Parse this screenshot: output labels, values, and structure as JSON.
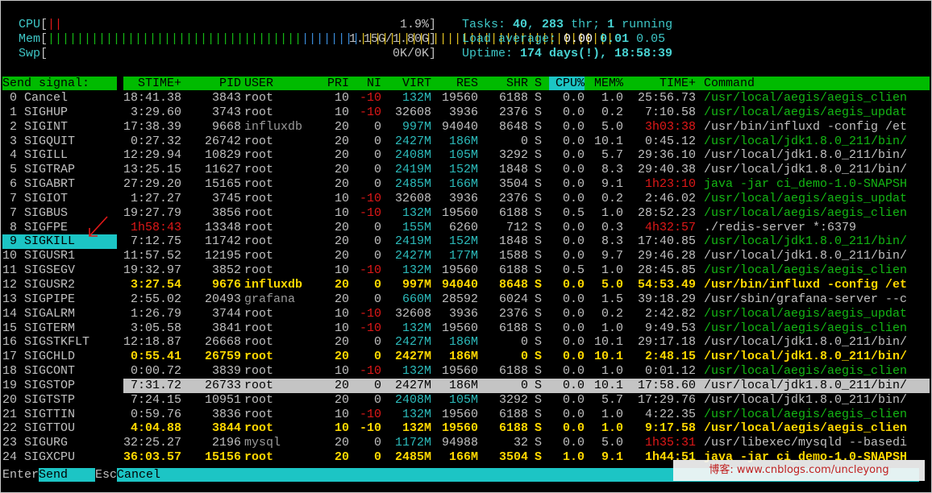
{
  "meters": [
    {
      "label": "CPU",
      "bar_text": "||",
      "bar_colors": [
        "#e01818",
        "#14b814"
      ],
      "value": "1.9%"
    },
    {
      "label": "Mem",
      "bar_text": "||||||||||||||||||||||||||||||||||||||||||||||||||||||||||||||||||||||||||||||",
      "value": "1.15G/1.80G"
    },
    {
      "label": "Swp",
      "bar_text": "",
      "value": "0K/0K"
    }
  ],
  "stats": {
    "tasks_label": "Tasks: ",
    "tasks": "40",
    "sep1": ", ",
    "threads": "283",
    "thr_label": " thr; ",
    "running": "1",
    "running_label": " running",
    "load_label": "Load average: ",
    "load1": "0.00",
    "load5": "0.01",
    "load15": "0.05",
    "uptime_label": "Uptime: ",
    "uptime": "174 days(!), 18:58:39"
  },
  "signal_panel": {
    "header": "Send signal:",
    "selected_index": 9,
    "signals": [
      " 0 Cancel",
      " 1 SIGHUP",
      " 2 SIGINT",
      " 3 SIGQUIT",
      " 4 SIGILL",
      " 5 SIGTRAP",
      " 6 SIGABRT",
      " 7 SIGIOT",
      " 7 SIGBUS",
      " 8 SIGFPE",
      " 9 SIGKILL",
      "10 SIGUSR1",
      "11 SIGSEGV",
      "12 SIGUSR2",
      "13 SIGPIPE",
      "14 SIGALRM",
      "15 SIGTERM",
      "16 SIGSTKFLT",
      "17 SIGCHLD",
      "18 SIGCONT",
      "19 SIGSTOP",
      "20 SIGTSTP",
      "21 SIGTTIN",
      "22 SIGTTOU",
      "23 SIGURG",
      "24 SIGXCPU"
    ]
  },
  "columns": [
    "STIME+",
    "PID",
    "USER",
    "PRI",
    "NI",
    "VIRT",
    "RES",
    "SHR",
    "S",
    "CPU%",
    "MEM%",
    "TIME+",
    "Command"
  ],
  "sort_column": "CPU%",
  "processes": [
    {
      "stime": "18:41.38",
      "pid": "3843",
      "user": "root",
      "pri": "10",
      "ni": "-10",
      "virt": "132M",
      "res": "19560",
      "shr": "6188",
      "s": "S",
      "cpu": "0.0",
      "mem": "1.0",
      "time": "25:56.73",
      "cmd": "/usr/local/aegis/aegis_clien",
      "style": "green"
    },
    {
      "stime": "3:29.60",
      "pid": "3743",
      "user": "root",
      "pri": "10",
      "ni": "-10",
      "virt": "32608",
      "res": "3936",
      "shr": "2376",
      "s": "S",
      "cpu": "0.0",
      "mem": "0.2",
      "time": "7:10.58",
      "cmd": "/usr/local/aegis/aegis_updat",
      "style": "green"
    },
    {
      "stime": "17:38.39",
      "pid": "9668",
      "user": "influxdb",
      "pri": "20",
      "ni": "0",
      "virt": "997M",
      "res": "94040",
      "shr": "8648",
      "s": "S",
      "cpu": "0.0",
      "mem": "5.0",
      "time": "3h03:38",
      "cmd": "/usr/bin/influxd -config /et",
      "style": "white"
    },
    {
      "stime": "0:27.32",
      "pid": "26742",
      "user": "root",
      "pri": "20",
      "ni": "0",
      "virt": "2427M",
      "res": "186M",
      "shr": "0",
      "s": "S",
      "cpu": "0.0",
      "mem": "10.1",
      "time": "0:45.12",
      "cmd": "/usr/local/jdk1.8.0_211/bin/",
      "style": "green"
    },
    {
      "stime": "12:29.94",
      "pid": "10829",
      "user": "root",
      "pri": "20",
      "ni": "0",
      "virt": "2408M",
      "res": "105M",
      "shr": "3292",
      "s": "S",
      "cpu": "0.0",
      "mem": "5.7",
      "time": "29:36.10",
      "cmd": "/usr/local/jdk1.8.0_211/bin/",
      "style": "white"
    },
    {
      "stime": "13:25.15",
      "pid": "11627",
      "user": "root",
      "pri": "20",
      "ni": "0",
      "virt": "2419M",
      "res": "152M",
      "shr": "1848",
      "s": "S",
      "cpu": "0.0",
      "mem": "8.3",
      "time": "29:40.38",
      "cmd": "/usr/local/jdk1.8.0_211/bin/",
      "style": "white"
    },
    {
      "stime": "27:29.20",
      "pid": "15165",
      "user": "root",
      "pri": "20",
      "ni": "0",
      "virt": "2485M",
      "res": "166M",
      "shr": "3504",
      "s": "S",
      "cpu": "0.0",
      "mem": "9.1",
      "time": "1h23:10",
      "cmd": "java -jar ci_demo-1.0-SNAPSH",
      "style": "green"
    },
    {
      "stime": "1:27.27",
      "pid": "3745",
      "user": "root",
      "pri": "10",
      "ni": "-10",
      "virt": "32608",
      "res": "3936",
      "shr": "2376",
      "s": "S",
      "cpu": "0.0",
      "mem": "0.2",
      "time": "2:46.02",
      "cmd": "/usr/local/aegis/aegis_updat",
      "style": "green"
    },
    {
      "stime": "19:27.79",
      "pid": "3856",
      "user": "root",
      "pri": "10",
      "ni": "-10",
      "virt": "132M",
      "res": "19560",
      "shr": "6188",
      "s": "S",
      "cpu": "0.5",
      "mem": "1.0",
      "time": "28:52.23",
      "cmd": "/usr/local/aegis/aegis_clien",
      "style": "green"
    },
    {
      "stime": "1h58:43",
      "pid": "13348",
      "user": "root",
      "pri": "20",
      "ni": "0",
      "virt": "155M",
      "res": "6260",
      "shr": "712",
      "s": "S",
      "cpu": "0.0",
      "mem": "0.3",
      "time": "4h32:57",
      "cmd": "./redis-server *:6379",
      "style": "white"
    },
    {
      "stime": "7:12.75",
      "pid": "11742",
      "user": "root",
      "pri": "20",
      "ni": "0",
      "virt": "2419M",
      "res": "152M",
      "shr": "1848",
      "s": "S",
      "cpu": "0.0",
      "mem": "8.3",
      "time": "17:40.85",
      "cmd": "/usr/local/jdk1.8.0_211/bin/",
      "style": "green"
    },
    {
      "stime": "11:57.52",
      "pid": "12195",
      "user": "root",
      "pri": "20",
      "ni": "0",
      "virt": "2427M",
      "res": "177M",
      "shr": "1588",
      "s": "S",
      "cpu": "0.0",
      "mem": "9.7",
      "time": "29:46.28",
      "cmd": "/usr/local/jdk1.8.0_211/bin/",
      "style": "white"
    },
    {
      "stime": "19:32.97",
      "pid": "3852",
      "user": "root",
      "pri": "10",
      "ni": "-10",
      "virt": "132M",
      "res": "19560",
      "shr": "6188",
      "s": "S",
      "cpu": "0.5",
      "mem": "1.0",
      "time": "28:45.85",
      "cmd": "/usr/local/aegis/aegis_clien",
      "style": "green"
    },
    {
      "stime": "3:27.54",
      "pid": "9676",
      "user": "influxdb",
      "pri": "20",
      "ni": "0",
      "virt": "997M",
      "res": "94040",
      "shr": "8648",
      "s": "S",
      "cpu": "0.0",
      "mem": "5.0",
      "time": "54:53.49",
      "cmd": "/usr/bin/influxd -config /et",
      "style": "tagged"
    },
    {
      "stime": "2:55.02",
      "pid": "20493",
      "user": "grafana",
      "pri": "20",
      "ni": "0",
      "virt": "660M",
      "res": "28592",
      "shr": "6024",
      "s": "S",
      "cpu": "0.0",
      "mem": "1.5",
      "time": "39:18.29",
      "cmd": "/usr/sbin/grafana-server --c",
      "style": "white"
    },
    {
      "stime": "1:26.79",
      "pid": "3744",
      "user": "root",
      "pri": "10",
      "ni": "-10",
      "virt": "32608",
      "res": "3936",
      "shr": "2376",
      "s": "S",
      "cpu": "0.0",
      "mem": "0.2",
      "time": "2:42.82",
      "cmd": "/usr/local/aegis/aegis_updat",
      "style": "green"
    },
    {
      "stime": "3:05.58",
      "pid": "3841",
      "user": "root",
      "pri": "10",
      "ni": "-10",
      "virt": "132M",
      "res": "19560",
      "shr": "6188",
      "s": "S",
      "cpu": "0.0",
      "mem": "1.0",
      "time": "9:49.53",
      "cmd": "/usr/local/aegis/aegis_clien",
      "style": "green"
    },
    {
      "stime": "12:18.87",
      "pid": "26668",
      "user": "root",
      "pri": "20",
      "ni": "0",
      "virt": "2427M",
      "res": "186M",
      "shr": "0",
      "s": "S",
      "cpu": "0.0",
      "mem": "10.1",
      "time": "29:17.18",
      "cmd": "/usr/local/jdk1.8.0_211/bin/",
      "style": "white"
    },
    {
      "stime": "0:55.41",
      "pid": "26759",
      "user": "root",
      "pri": "20",
      "ni": "0",
      "virt": "2427M",
      "res": "186M",
      "shr": "0",
      "s": "S",
      "cpu": "0.0",
      "mem": "10.1",
      "time": "2:48.15",
      "cmd": "/usr/local/jdk1.8.0_211/bin/",
      "style": "tagged"
    },
    {
      "stime": "0:00.72",
      "pid": "3839",
      "user": "root",
      "pri": "10",
      "ni": "-10",
      "virt": "132M",
      "res": "19560",
      "shr": "6188",
      "s": "S",
      "cpu": "0.0",
      "mem": "1.0",
      "time": "0:01.12",
      "cmd": "/usr/local/aegis/aegis_clien",
      "style": "green"
    },
    {
      "stime": "7:31.72",
      "pid": "26733",
      "user": "root",
      "pri": "20",
      "ni": "0",
      "virt": "2427M",
      "res": "186M",
      "shr": "0",
      "s": "S",
      "cpu": "0.0",
      "mem": "10.1",
      "time": "17:58.60",
      "cmd": "/usr/local/jdk1.8.0_211/bin/",
      "style": "highlight"
    },
    {
      "stime": "7:24.15",
      "pid": "10951",
      "user": "root",
      "pri": "20",
      "ni": "0",
      "virt": "2408M",
      "res": "105M",
      "shr": "3292",
      "s": "S",
      "cpu": "0.0",
      "mem": "5.7",
      "time": "17:29.76",
      "cmd": "/usr/local/jdk1.8.0_211/bin/",
      "style": "white"
    },
    {
      "stime": "0:59.76",
      "pid": "3836",
      "user": "root",
      "pri": "10",
      "ni": "-10",
      "virt": "132M",
      "res": "19560",
      "shr": "6188",
      "s": "S",
      "cpu": "0.0",
      "mem": "1.0",
      "time": "4:22.35",
      "cmd": "/usr/local/aegis/aegis_clien",
      "style": "green"
    },
    {
      "stime": "4:04.88",
      "pid": "3844",
      "user": "root",
      "pri": "10",
      "ni": "-10",
      "virt": "132M",
      "res": "19560",
      "shr": "6188",
      "s": "S",
      "cpu": "0.0",
      "mem": "1.0",
      "time": "9:17.58",
      "cmd": "/usr/local/aegis/aegis_clien",
      "style": "tagged"
    },
    {
      "stime": "32:25.27",
      "pid": "2196",
      "user": "mysql",
      "pri": "20",
      "ni": "0",
      "virt": "1172M",
      "res": "94988",
      "shr": "32",
      "s": "S",
      "cpu": "0.0",
      "mem": "5.0",
      "time": "1h35:31",
      "cmd": "/usr/libexec/mysqld --basedi",
      "style": "white"
    },
    {
      "stime": "36:03.57",
      "pid": "15156",
      "user": "root",
      "pri": "20",
      "ni": "0",
      "virt": "2485M",
      "res": "166M",
      "shr": "3504",
      "s": "S",
      "cpu": "1.0",
      "mem": "9.1",
      "time": "1h44:51",
      "cmd": "java -jar ci_demo-1.0-SNAPSH",
      "style": "tagged"
    }
  ],
  "footer": {
    "enter_key": "Enter",
    "enter_action": "Send",
    "esc_key": "Esc",
    "esc_action": "Cancel"
  },
  "watermark": "博客: www.cnblogs.com/uncleyong",
  "colors": {
    "header_green": "#00bb00",
    "selection_cyan": "#1cc5c5",
    "tagged_yellow": "#ffd800",
    "row_highlight": "#c4c4c4",
    "annotation_red": "#e01818"
  }
}
